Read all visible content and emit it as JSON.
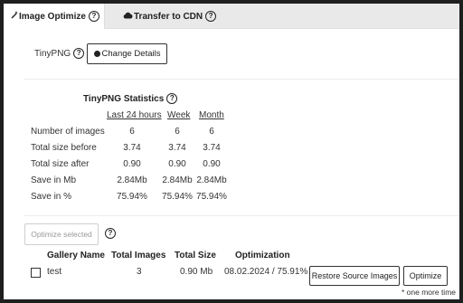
{
  "tabs": {
    "image_optimize": {
      "label": "Image Optimize",
      "help": "?"
    },
    "transfer_cdn": {
      "label": "Transfer to CDN",
      "help": "?"
    }
  },
  "tinypng": {
    "label": "TinyPNG",
    "help": "?",
    "change_details_label": "Change Details"
  },
  "stats": {
    "title": "TinyPNG Statistics",
    "help": "?",
    "columns": [
      "Last 24 hours",
      "Week",
      "Month"
    ],
    "rows": [
      {
        "label": "Number of images",
        "values": [
          "6",
          "6",
          "6"
        ]
      },
      {
        "label": "Total size before",
        "values": [
          "3.74",
          "3.74",
          "3.74"
        ]
      },
      {
        "label": "Total size after",
        "values": [
          "0.90",
          "0.90",
          "0.90"
        ]
      },
      {
        "label": "Save in Mb",
        "values": [
          "2.84Mb",
          "2.84Mb",
          "2.84Mb"
        ]
      },
      {
        "label": "Save in %",
        "values": [
          "75.94%",
          "75.94%",
          "75.94%"
        ]
      }
    ]
  },
  "galleries": {
    "optimize_selected_label": "Optimize selected",
    "help": "?",
    "headers": {
      "name": "Gallery Name",
      "total_images": "Total Images",
      "total_size": "Total Size",
      "optimization": "Optimization"
    },
    "rows": [
      {
        "name": "test",
        "total_images": "3",
        "total_size": "0.90 Mb",
        "optimization": "08.02.2024 / 75.91%",
        "restore_label": "Restore Source Images",
        "optimize_label": "Optimize",
        "note": "* one more time"
      }
    ]
  }
}
